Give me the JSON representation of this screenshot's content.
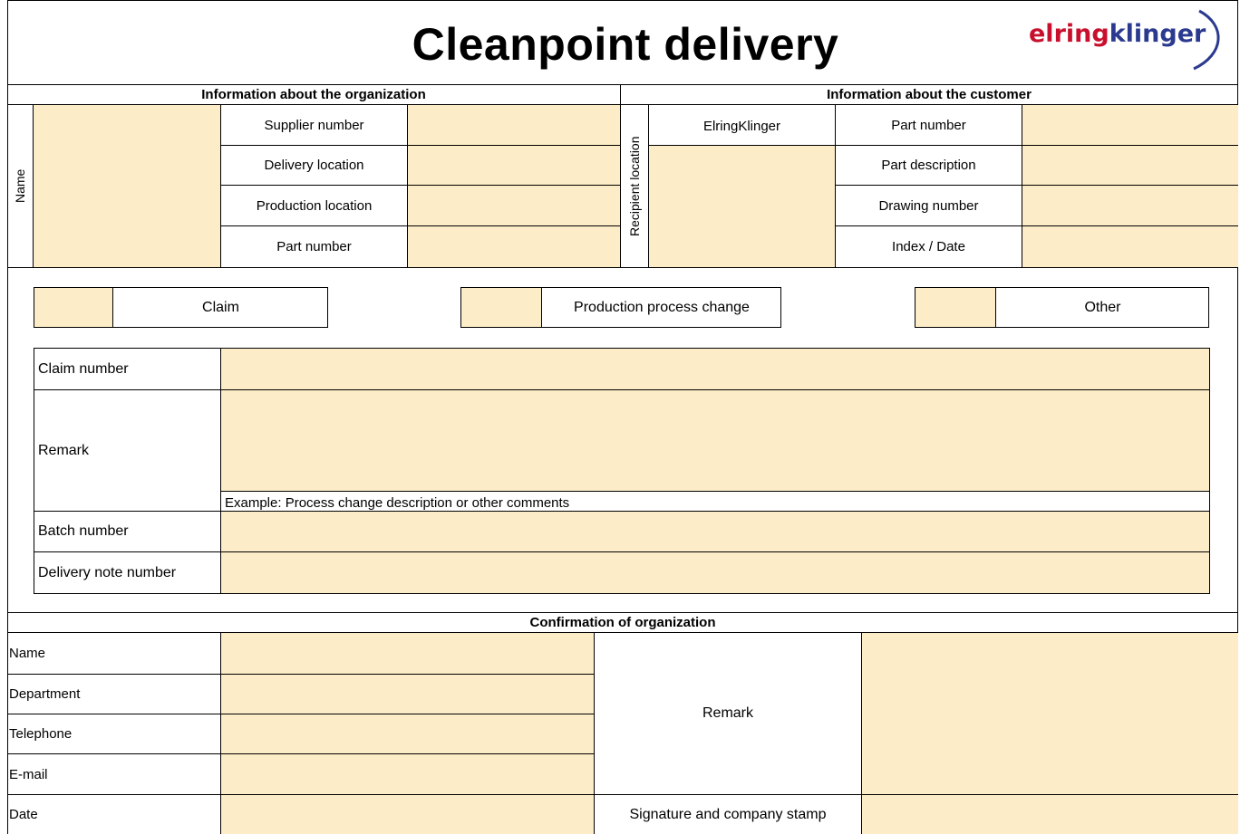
{
  "title": "Cleanpoint delivery",
  "logo": {
    "part1": "elring",
    "part2": "klinger",
    "color1": "#c8102e",
    "color2": "#2b3a8f"
  },
  "org": {
    "header": "Information about the organization",
    "name_label": "Name",
    "supplier_number": "Supplier number",
    "delivery_location": "Delivery location",
    "production_location": "Production location",
    "part_number": "Part number"
  },
  "customer": {
    "header": "Information about the customer",
    "recipient_location": "Recipient location",
    "company": "ElringKlinger",
    "part_number": "Part number",
    "part_description": "Part description",
    "drawing_number": "Drawing number",
    "index_date": "Index / Date"
  },
  "options": {
    "claim": "Claim",
    "process_change": "Production process change",
    "other": "Other"
  },
  "details": {
    "claim_number": "Claim number",
    "remark": "Remark",
    "remark_hint": "Example: Process change description or other comments",
    "batch_number": "Batch number",
    "delivery_note_number": "Delivery note number"
  },
  "confirmation": {
    "header": "Confirmation of organization",
    "name": "Name",
    "department": "Department",
    "telephone": "Telephone",
    "email": "E-mail",
    "date": "Date",
    "remark": "Remark",
    "signature": "Signature and company stamp"
  },
  "colors": {
    "fill": "#fdecc8",
    "border": "#000000"
  }
}
